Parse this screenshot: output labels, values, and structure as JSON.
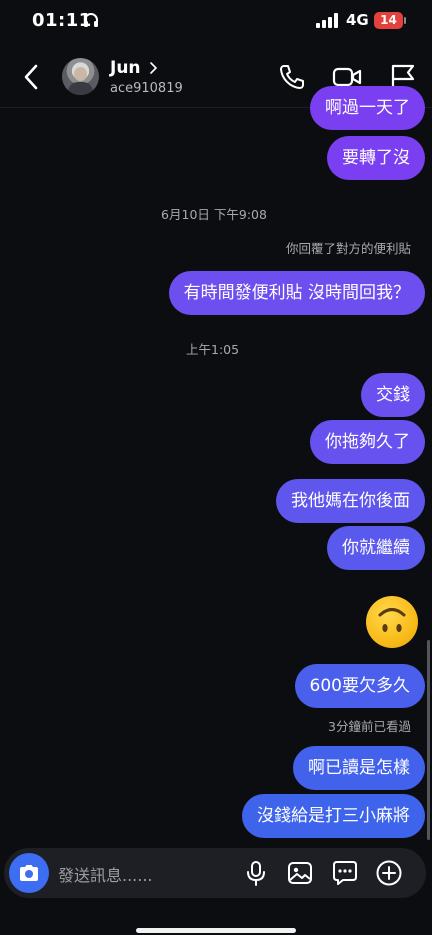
{
  "status": {
    "time": "01:11",
    "network": "4G",
    "battery": "14"
  },
  "header": {
    "name": "Jun",
    "handle": "ace910819"
  },
  "messages": {
    "m1": "啊過一天了",
    "m2": "要轉了沒",
    "ts1": "6月10日 下午9:08",
    "reply_note": "你回覆了對方的便利貼",
    "m3": "有時間發便利貼 沒時間回我？",
    "ts2": "上午1:05",
    "m4": "交錢",
    "m5": "你拖夠久了",
    "m6": "我他媽在你後面",
    "m7": "你就繼續",
    "m8": "600要欠多久",
    "seen": "3分鐘前已看過",
    "m9": "啊已讀是怎樣",
    "m10": "沒錢給是打三小麻將"
  },
  "composer": {
    "placeholder": "發送訊息......"
  },
  "colors": {
    "bubble_purple": "#7a3ff0",
    "bubble_blue": "#3f64ec",
    "background": "#0c0d10"
  },
  "icons": [
    "headphones-icon",
    "signal-icon",
    "back-arrow-icon",
    "phone-icon",
    "video-icon",
    "flag-icon",
    "camera-icon",
    "microphone-icon",
    "gallery-icon",
    "sticker-icon",
    "plus-icon",
    "upside-down-face-emoji"
  ]
}
